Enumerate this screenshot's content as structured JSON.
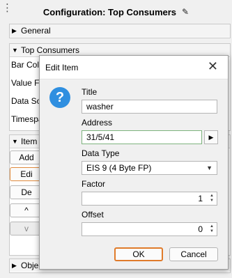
{
  "panel": {
    "title": "Configuration: Top Consumers",
    "sections": {
      "general": "General",
      "top_consumers": "Top Consumers",
      "items": "Item",
      "objects": "Obje"
    },
    "row_labels": [
      "Bar Colo",
      "Value Fo",
      "Data So",
      "Timespa"
    ],
    "side_buttons": [
      "Add",
      "Edi",
      "De",
      "^",
      "v"
    ]
  },
  "dialog": {
    "title": "Edit Item",
    "fields": {
      "title_label": "Title",
      "title_value": "washer",
      "address_label": "Address",
      "address_value": "31/5/41",
      "data_type_label": "Data Type",
      "data_type_value": "EIS 9 (4 Byte FP)",
      "factor_label": "Factor",
      "factor_value": "1",
      "offset_label": "Offset",
      "offset_value": "0"
    },
    "ok_label": "OK",
    "cancel_label": "Cancel"
  }
}
